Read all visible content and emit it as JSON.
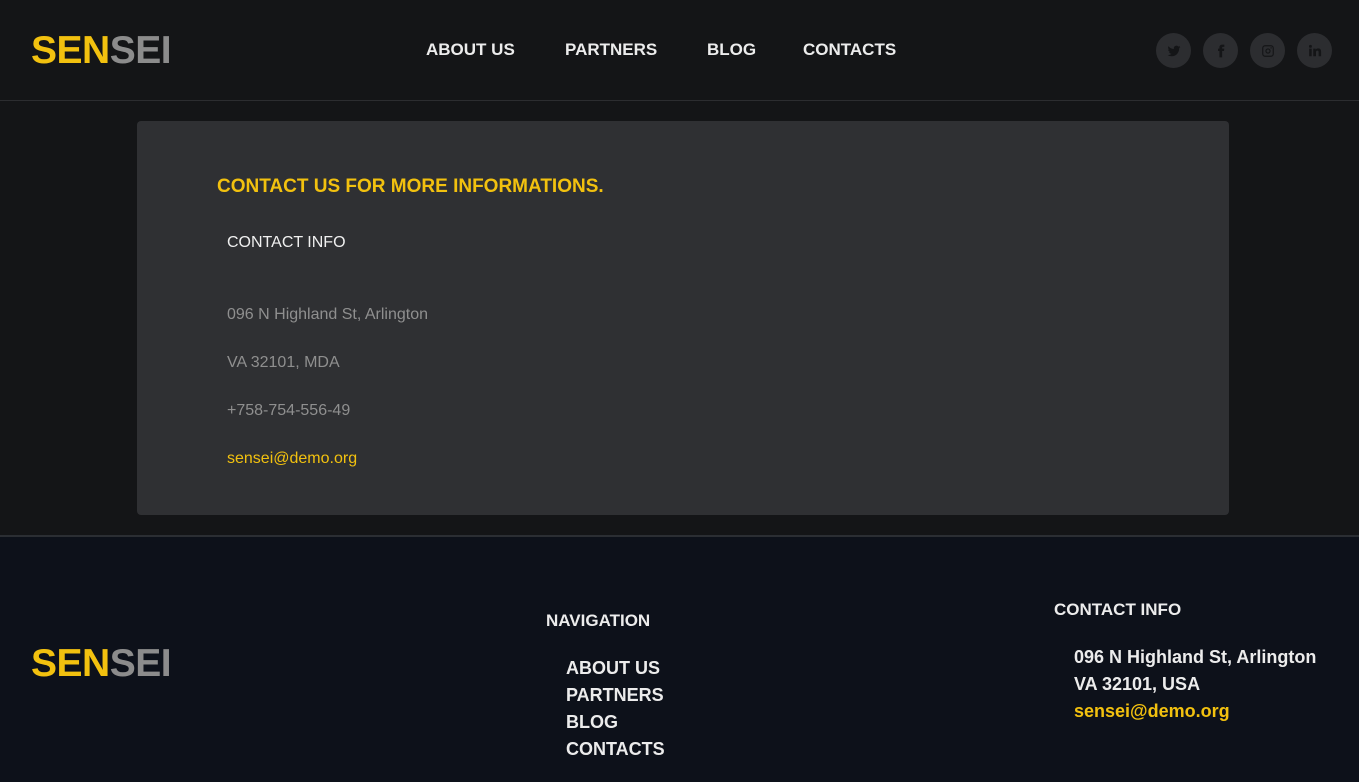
{
  "brand": {
    "part1": "SEN",
    "part2": "SEI",
    "accent_color": "#f2c10f",
    "muted_color": "#8c8c8c"
  },
  "nav": {
    "items": [
      {
        "label": "ABOUT US"
      },
      {
        "label": "PARTNERS"
      },
      {
        "label": "BLOG"
      },
      {
        "label": "CONTACTS"
      }
    ]
  },
  "social": {
    "icons": [
      "twitter-icon",
      "facebook-icon",
      "instagram-icon",
      "linkedin-icon"
    ]
  },
  "contact_card": {
    "title": "CONTACT US FOR MORE INFORMATIONS.",
    "subtitle": "CONTACT INFO",
    "address_line1": "096 N Highland St, Arlington",
    "address_line2": "VA 32101, MDA",
    "phone": "+758-754-556-49",
    "email": "sensei@demo.org"
  },
  "footer": {
    "navigation_heading": "NAVIGATION",
    "links": [
      {
        "label": "ABOUT US"
      },
      {
        "label": "PARTNERS"
      },
      {
        "label": "BLOG"
      },
      {
        "label": "CONTACTS"
      }
    ],
    "contact_heading": "CONTACT INFO",
    "address_line1": "096 N Highland St, Arlington",
    "address_line2": "VA 32101, USA",
    "email": "sensei@demo.org"
  }
}
